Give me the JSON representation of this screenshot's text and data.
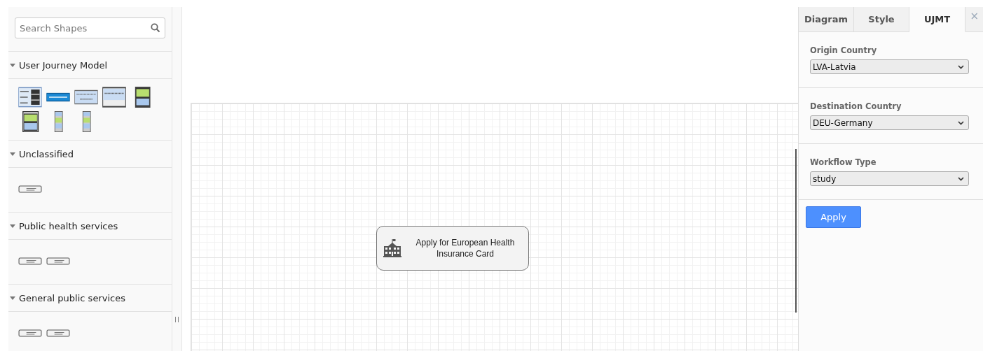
{
  "search": {
    "placeholder": "Search Shapes"
  },
  "sections": [
    {
      "title": "User Journey Model",
      "expanded": true,
      "shapes": [
        {
          "kind": "form"
        },
        {
          "kind": "bar"
        },
        {
          "kind": "card"
        },
        {
          "kind": "grey-card"
        },
        {
          "kind": "green-doc"
        },
        {
          "kind": "green-doc-frame"
        },
        {
          "kind": "tall"
        },
        {
          "kind": "tall"
        }
      ]
    },
    {
      "title": "Unclassified",
      "expanded": true,
      "shapes": [
        {
          "kind": "service"
        }
      ]
    },
    {
      "title": "Public health services",
      "expanded": true,
      "shapes": [
        {
          "kind": "service"
        },
        {
          "kind": "service"
        }
      ]
    },
    {
      "title": "General public services",
      "expanded": true,
      "shapes": [
        {
          "kind": "service"
        },
        {
          "kind": "service"
        }
      ]
    }
  ],
  "canvas": {
    "nodes": [
      {
        "kind": "service",
        "text": "Apply for European Health Insurance Card"
      }
    ]
  },
  "panel": {
    "tabs": [
      {
        "label": "Diagram",
        "selected": false
      },
      {
        "label": "Style",
        "selected": false
      },
      {
        "label": "UJMT",
        "selected": true
      }
    ],
    "close": "×",
    "fields": [
      {
        "label": "Origin Country",
        "value": "LVA-Latvia"
      },
      {
        "label": "Destination Country",
        "value": "DEU-Germany"
      },
      {
        "label": "Workflow Type",
        "value": "study"
      }
    ],
    "button": "Apply"
  }
}
